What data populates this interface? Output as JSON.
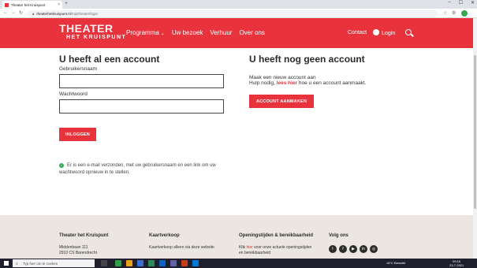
{
  "browser": {
    "tab_title": "Theater het Kruispunt",
    "tab_close": "×",
    "new_tab": "+",
    "win_min": "–",
    "win_max": "☐",
    "win_close": "✕",
    "url_domain": "theaterhetkruispunt.nl",
    "url_path": "/mijntheater/login"
  },
  "header": {
    "logo_line1": "THEATER",
    "logo_line2": "HET KRUISPUNT",
    "nav": [
      {
        "label": "Programma",
        "has_dropdown": true
      },
      {
        "label": "Uw bezoek"
      },
      {
        "label": "Verhuur"
      },
      {
        "label": "Over ons"
      }
    ],
    "contact": "Contact",
    "login": "Login"
  },
  "login": {
    "title": "U heeft al een account",
    "username_label": "Gebruikersnaam",
    "username_value": "",
    "password_label": "Wachtwoord",
    "password_value": "",
    "submit": "INLOGGEN",
    "message": "Er is een e-mail verzonden, met uw gebruikersnaam en een link om uw wachtwoord opnieuw in te stellen."
  },
  "register": {
    "title": "U heeft nog geen account",
    "line1": "Maak een nieuw account aan",
    "line2_before": "Hulp nodig, ",
    "line2_link": "lees hier",
    "line2_after": " hoe u een account aanmaakt.",
    "button": "ACCOUNT AANMAKEN"
  },
  "footer": {
    "col1_title": "Theater het Kruispunt",
    "col1_line1": "Middenbaan 111",
    "col1_line2": "2910 CS Barendrecht",
    "col2_title": "Kaartverkoop",
    "col2_text": "Kaartverkoop alleen via deze website",
    "col3_title": "Openingstijden & bereikbaarheid",
    "col3_before": "Klik ",
    "col3_link": "hier",
    "col3_after": " voor onze actuele openingstijden",
    "col3_line2": "en bereikbaarheid",
    "col4_title": "Volg ons",
    "socials": [
      "twitter",
      "facebook",
      "youtube",
      "linkedin",
      "instagram"
    ]
  },
  "taskbar": {
    "search_placeholder": "Typ hier om te zoeken",
    "weather": "16°C  Bewolkt",
    "time": "09:16",
    "date": "23-7-2021"
  },
  "colors": {
    "brand_red": "#e8323c",
    "footer_bg": "#ebe7e0"
  }
}
